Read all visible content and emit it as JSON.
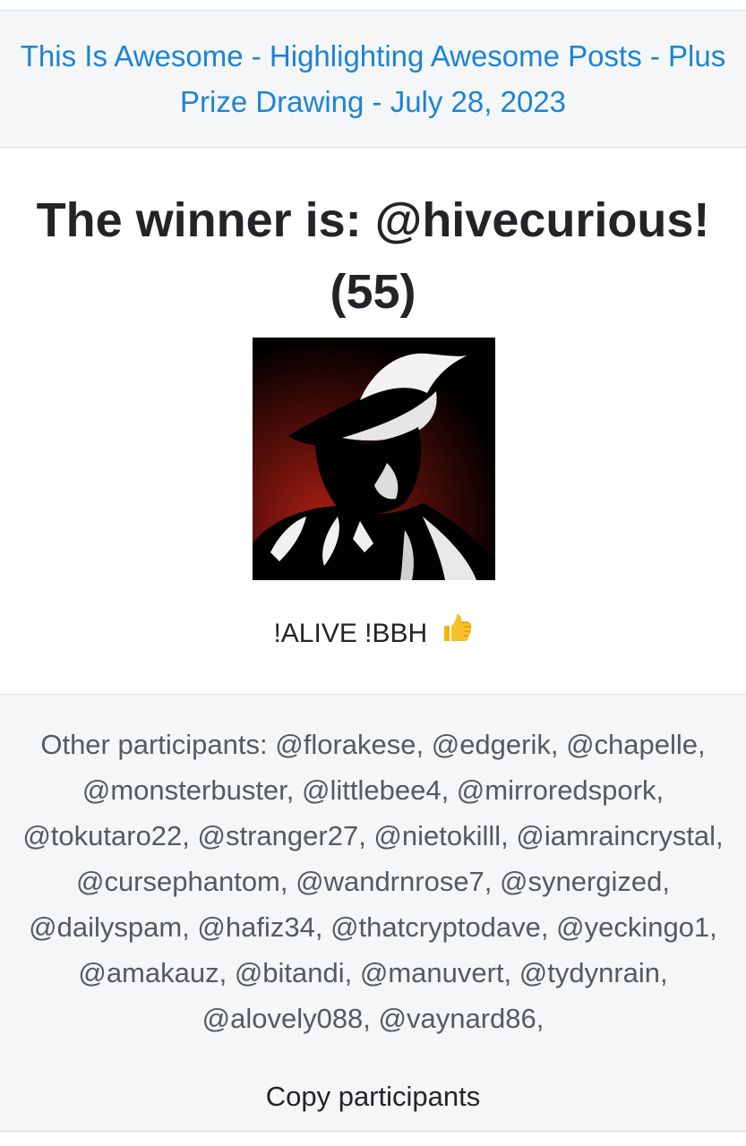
{
  "header": {
    "title": "This Is Awesome - Highlighting Awesome Posts - Plus Prize Drawing - July 28, 2023"
  },
  "winner": {
    "text": "The winner is: @hivecurious! (55)"
  },
  "avatar": {
    "icon": "detective-fedora-silhouette"
  },
  "commands": {
    "text": "!ALIVE !BBH",
    "emoji": "thumbs-up-icon"
  },
  "participants": {
    "text": "Other participants: @florakese, @edgerik, @chapelle, @monsterbuster, @littlebee4, @mirroredspork, @tokutaro22, @stranger27, @nietokilll, @iamraincrystal, @cursephantom, @wandrnrose7, @synergized, @dailyspam, @hafiz34, @thatcryptodave, @yeckingo1, @amakauz, @bitandi, @manuvert, @tydynrain, @alovely088, @vaynard86,",
    "copy_label": "Copy participants"
  },
  "colors": {
    "link": "#1c84d4",
    "panel": "#f5f6f7",
    "text_dark": "#222428",
    "text_muted": "#555a60"
  }
}
